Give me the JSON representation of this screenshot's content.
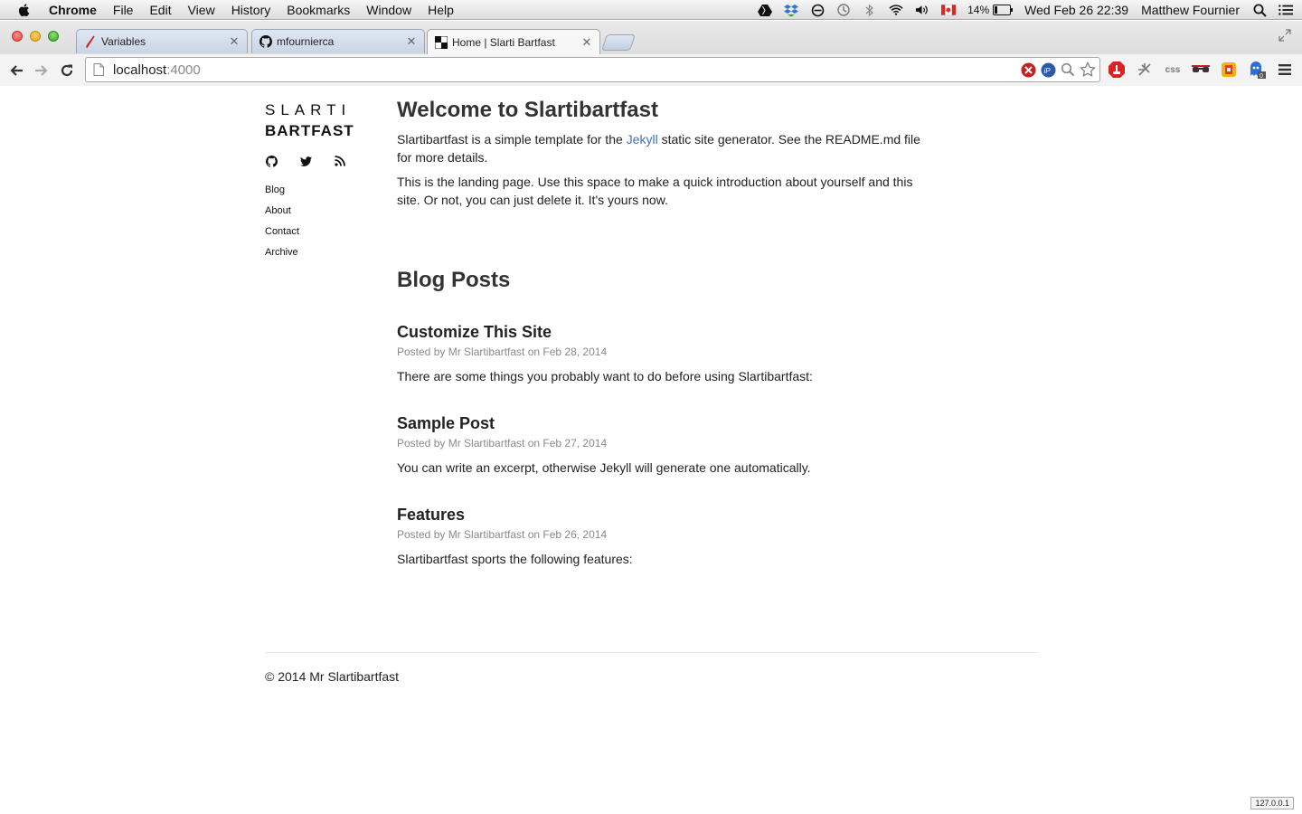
{
  "menubar": {
    "app_name": "Chrome",
    "items": [
      "File",
      "Edit",
      "View",
      "History",
      "Bookmarks",
      "Window",
      "Help"
    ],
    "battery": "14%",
    "datetime": "Wed Feb 26  22:39",
    "user": "Matthew Fournier"
  },
  "tabs": [
    {
      "label": "Variables",
      "active": false
    },
    {
      "label": "mfournierca",
      "active": false
    },
    {
      "label": "Home | Slarti Bartfast",
      "active": true
    }
  ],
  "toolbar": {
    "url_host": "localhost",
    "url_port": ":4000"
  },
  "sidebar": {
    "brand_line1": "SLARTI",
    "brand_line2": "BARTFAST",
    "social": [
      "github-icon",
      "twitter-icon",
      "rss-icon"
    ],
    "nav": [
      "Blog",
      "About",
      "Contact",
      "Archive"
    ]
  },
  "main": {
    "title": "Welcome to Slartibartfast",
    "intro1_before": "Slartibartfast is a simple template for the ",
    "intro1_link": "Jekyll",
    "intro1_after": " static site generator. See the README.md file for more details.",
    "intro2": "This is the landing page. Use this space to make a quick introduction about yourself and this site. Or not, you can just delete it. It's yours now.",
    "blog_title": "Blog Posts",
    "posts": [
      {
        "title": "Customize This Site",
        "meta": "Posted by Mr Slartibartfast on Feb 28, 2014",
        "excerpt": "There are some things you probably want to do before using Slartibartfast:"
      },
      {
        "title": "Sample Post",
        "meta": "Posted by Mr Slartibartfast on Feb 27, 2014",
        "excerpt": "You can write an excerpt, otherwise Jekyll will generate one automatically."
      },
      {
        "title": "Features",
        "meta": "Posted by Mr Slartibartfast on Feb 26, 2014",
        "excerpt": "Slartibartfast sports the following features:"
      }
    ]
  },
  "footer": {
    "copyright": "© 2014 Mr Slartibartfast"
  },
  "status": {
    "ip": "127.0.0.1"
  },
  "colors": {
    "link": "#3b73b9",
    "meta": "#8a8a8a"
  }
}
